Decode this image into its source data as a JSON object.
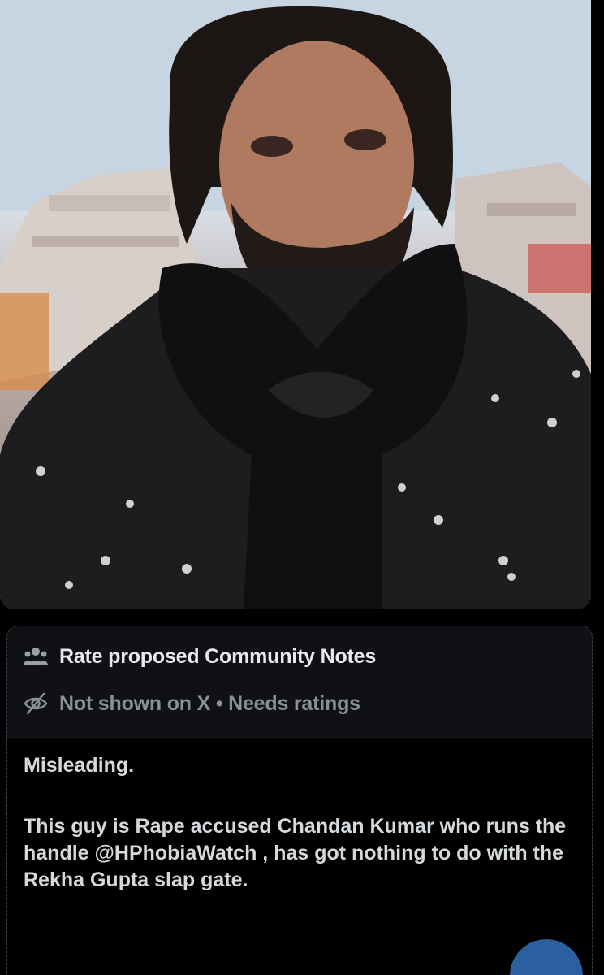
{
  "photo": {
    "alt_icon": "portrait-photo"
  },
  "note": {
    "title": "Rate proposed Community Notes",
    "title_icon": "people-icon",
    "status": "Not shown on X • Needs ratings",
    "status_icon": "eye-off-icon",
    "classification": "Misleading.",
    "text": "This guy is Rape accused Chandan Kumar who runs the handle @HPhobiaWatch , has got nothing to do with the Rekha Gupta slap gate."
  },
  "colors": {
    "background": "#000000",
    "card": "#101114",
    "primary_text": "#e7e9ea",
    "muted_text": "#8b9096",
    "fab": "#2b5fa0"
  }
}
